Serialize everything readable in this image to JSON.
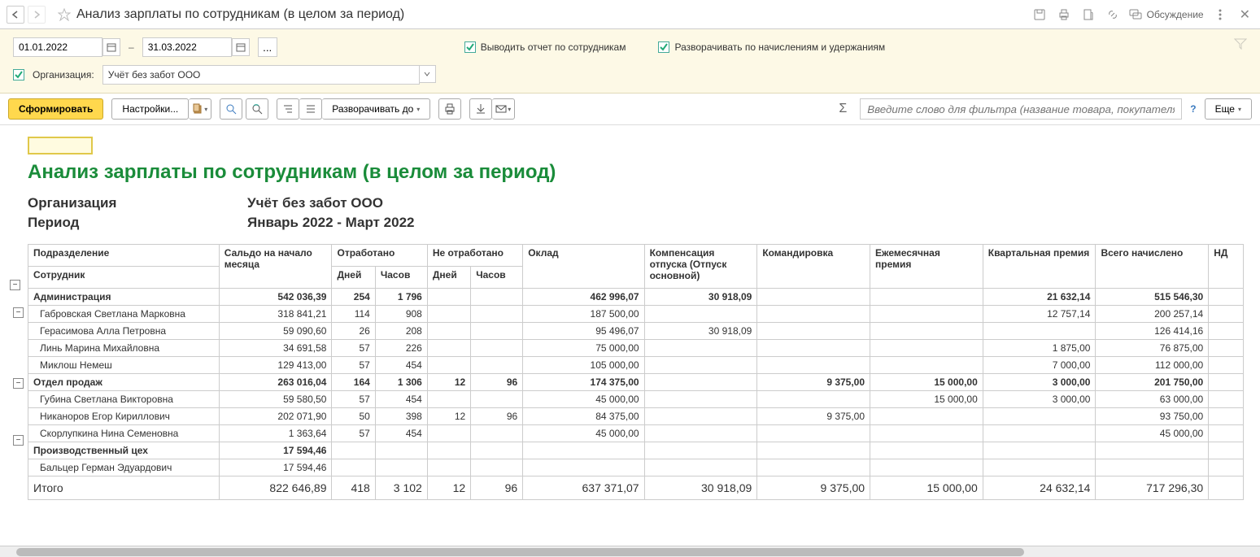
{
  "titlebar": {
    "title": "Анализ зарплаты по сотрудникам (в целом за период)",
    "discuss": "Обсуждение"
  },
  "filter": {
    "date_from": "01.01.2022",
    "date_to": "31.03.2022",
    "chk1": "Выводить отчет по сотрудникам",
    "chk2": "Разворачивать по начислениям и удержаниям",
    "org_label": "Организация:",
    "org_value": "Учёт без забот ООО"
  },
  "toolbar": {
    "generate": "Сформировать",
    "settings": "Настройки...",
    "expand_to": "Разворачивать до",
    "filter_placeholder": "Введите слово для фильтра (название товара, покупателя и п...",
    "more": "Еще",
    "help": "?"
  },
  "report": {
    "title": "Анализ зарплаты по сотрудникам (в целом за период)",
    "meta": {
      "org_label": "Организация",
      "org_value": "Учёт без забот ООО",
      "period_label": "Период",
      "period_value": "Январь 2022 - Март 2022"
    },
    "headers": {
      "dept": "Подразделение",
      "emp": "Сотрудник",
      "saldo": "Сальдо на начало месяца",
      "worked": "Отработано",
      "not_worked": "Не отработано",
      "days": "Дней",
      "hours": "Часов",
      "salary": "Оклад",
      "comp": "Компенсация отпуска (Отпуск основной)",
      "trip": "Командировка",
      "monthly_bonus": "Ежемесячная премия",
      "quarterly_bonus": "Квартальная премия",
      "total_accrued": "Всего начислено",
      "ndfl": "НД"
    },
    "rows": [
      {
        "type": "group",
        "name": "Администрация",
        "saldo": "542 036,39",
        "wd": "254",
        "wh": "1 796",
        "nwd": "",
        "nwh": "",
        "salary": "462 996,07",
        "comp": "30 918,09",
        "trip": "",
        "mb": "",
        "qb": "21 632,14",
        "total": "515 546,30"
      },
      {
        "type": "emp",
        "name": "Габровская Светлана Марковна",
        "saldo": "318 841,21",
        "wd": "114",
        "wh": "908",
        "nwd": "",
        "nwh": "",
        "salary": "187 500,00",
        "comp": "",
        "trip": "",
        "mb": "",
        "qb": "12 757,14",
        "total": "200 257,14"
      },
      {
        "type": "emp",
        "name": "Герасимова Алла Петровна",
        "saldo": "59 090,60",
        "wd": "26",
        "wh": "208",
        "nwd": "",
        "nwh": "",
        "salary": "95 496,07",
        "comp": "30 918,09",
        "trip": "",
        "mb": "",
        "qb": "",
        "total": "126 414,16"
      },
      {
        "type": "emp",
        "name": "Линь Марина Михайловна",
        "saldo": "34 691,58",
        "wd": "57",
        "wh": "226",
        "nwd": "",
        "nwh": "",
        "salary": "75 000,00",
        "comp": "",
        "trip": "",
        "mb": "",
        "qb": "1 875,00",
        "total": "76 875,00"
      },
      {
        "type": "emp",
        "name": "Миклош Немеш",
        "saldo": "129 413,00",
        "wd": "57",
        "wh": "454",
        "nwd": "",
        "nwh": "",
        "salary": "105 000,00",
        "comp": "",
        "trip": "",
        "mb": "",
        "qb": "7 000,00",
        "total": "112 000,00"
      },
      {
        "type": "group",
        "name": "Отдел продаж",
        "saldo": "263 016,04",
        "wd": "164",
        "wh": "1 306",
        "nwd": "12",
        "nwh": "96",
        "salary": "174 375,00",
        "comp": "",
        "trip": "9 375,00",
        "mb": "15 000,00",
        "qb": "3 000,00",
        "total": "201 750,00"
      },
      {
        "type": "emp",
        "name": "Губина Светлана Викторовна",
        "saldo": "59 580,50",
        "wd": "57",
        "wh": "454",
        "nwd": "",
        "nwh": "",
        "salary": "45 000,00",
        "comp": "",
        "trip": "",
        "mb": "15 000,00",
        "qb": "3 000,00",
        "total": "63 000,00"
      },
      {
        "type": "emp",
        "name": "Никаноров Егор Кириллович",
        "saldo": "202 071,90",
        "wd": "50",
        "wh": "398",
        "nwd": "12",
        "nwh": "96",
        "salary": "84 375,00",
        "comp": "",
        "trip": "9 375,00",
        "mb": "",
        "qb": "",
        "total": "93 750,00"
      },
      {
        "type": "emp",
        "name": "Скорлупкина Нина Семеновна",
        "saldo": "1 363,64",
        "wd": "57",
        "wh": "454",
        "nwd": "",
        "nwh": "",
        "salary": "45 000,00",
        "comp": "",
        "trip": "",
        "mb": "",
        "qb": "",
        "total": "45 000,00"
      },
      {
        "type": "group",
        "name": "Производственный цех",
        "saldo": "17 594,46",
        "wd": "",
        "wh": "",
        "nwd": "",
        "nwh": "",
        "salary": "",
        "comp": "",
        "trip": "",
        "mb": "",
        "qb": "",
        "total": ""
      },
      {
        "type": "emp",
        "name": "Бальцер Герман Эдуардович",
        "saldo": "17 594,46",
        "wd": "",
        "wh": "",
        "nwd": "",
        "nwh": "",
        "salary": "",
        "comp": "",
        "trip": "",
        "mb": "",
        "qb": "",
        "total": ""
      }
    ],
    "total_row": {
      "name": "Итого",
      "saldo": "822 646,89",
      "wd": "418",
      "wh": "3 102",
      "nwd": "12",
      "nwh": "96",
      "salary": "637 371,07",
      "comp": "30 918,09",
      "trip": "9 375,00",
      "mb": "15 000,00",
      "qb": "24 632,14",
      "total": "717 296,30"
    }
  }
}
